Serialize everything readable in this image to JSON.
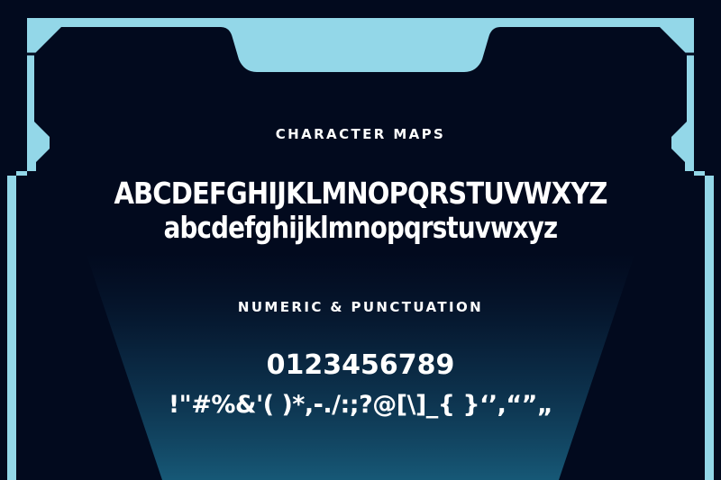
{
  "headings": {
    "character_maps": "CHARACTER MAPS",
    "numeric": "NUMERIC & PUNCTUATION"
  },
  "glyphs": {
    "uppercase": "ABCDEFGHIJKLMNOPQRSTUVWXYZ",
    "lowercase": "abcdefghijklmnopqrstuvwxyz",
    "digits": "0123456789",
    "punctuation": "!\"#%&'( )*,-./:;?@[\\]_{ }‘’,“”„"
  },
  "colors": {
    "background": "#020a1e",
    "frame": "#93d7e8",
    "text": "#ffffff",
    "beam": "#1a5f7a"
  }
}
